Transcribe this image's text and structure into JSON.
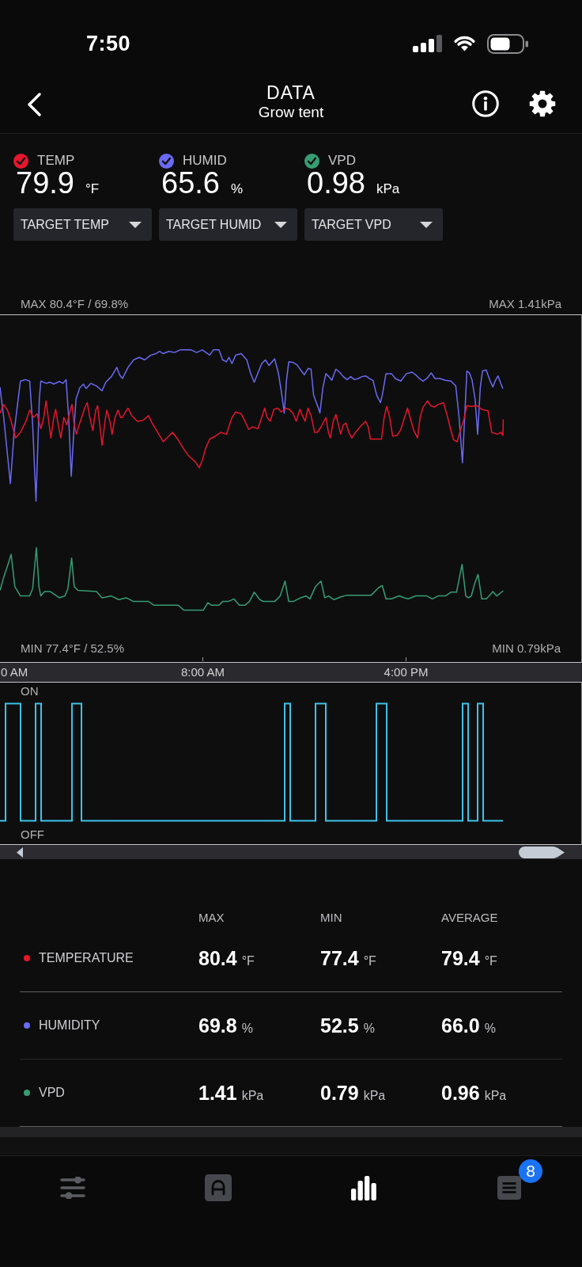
{
  "status_bar": {
    "time": "7:50"
  },
  "header": {
    "title": "DATA",
    "subtitle": "Grow tent"
  },
  "readings": [
    {
      "label": "TEMP",
      "checked": true,
      "color": "#e5162c",
      "value": "79.9",
      "unit": "°F",
      "target_dropdown": "TARGET TEMP"
    },
    {
      "label": "HUMID",
      "checked": true,
      "color": "#6a6af2",
      "value": "65.6",
      "unit": "%",
      "target_dropdown": "TARGET HUMID"
    },
    {
      "label": "VPD",
      "checked": true,
      "color": "#379d73",
      "value": "0.98",
      "unit": "kPa",
      "target_dropdown": "TARGET VPD"
    }
  ],
  "chart": {
    "max_left": "MAX 80.4°F / 69.8%",
    "max_right": "MAX 1.41kPa",
    "min_left": "MIN 77.4°F / 52.5%",
    "min_right": "MIN 0.79kPa",
    "time_labels": [
      "0 AM",
      "8:00 AM",
      "4:00 PM"
    ]
  },
  "switch_chart": {
    "on_label": "ON",
    "off_label": "OFF"
  },
  "stats": {
    "columns": [
      "MAX",
      "MIN",
      "AVERAGE"
    ],
    "rows": [
      {
        "name": "TEMPERATURE",
        "color": "#e5162c",
        "cells": [
          {
            "value": "80.4",
            "unit": "°F"
          },
          {
            "value": "77.4",
            "unit": "°F"
          },
          {
            "value": "79.4",
            "unit": "°F"
          }
        ]
      },
      {
        "name": "HUMIDITY",
        "color": "#6a6af2",
        "cells": [
          {
            "value": "69.8",
            "unit": "%"
          },
          {
            "value": "52.5",
            "unit": "%"
          },
          {
            "value": "66.0",
            "unit": "%"
          }
        ]
      },
      {
        "name": "VPD",
        "color": "#379d73",
        "cells": [
          {
            "value": "1.41",
            "unit": "kPa"
          },
          {
            "value": "0.79",
            "unit": "kPa"
          },
          {
            "value": "0.96",
            "unit": "kPa"
          }
        ]
      }
    ]
  },
  "tab_bar": {
    "items": [
      {
        "kind": "controls",
        "selected": false
      },
      {
        "kind": "device",
        "selected": false
      },
      {
        "kind": "data",
        "selected": true
      },
      {
        "kind": "log",
        "selected": false,
        "badge": "8"
      }
    ]
  }
}
